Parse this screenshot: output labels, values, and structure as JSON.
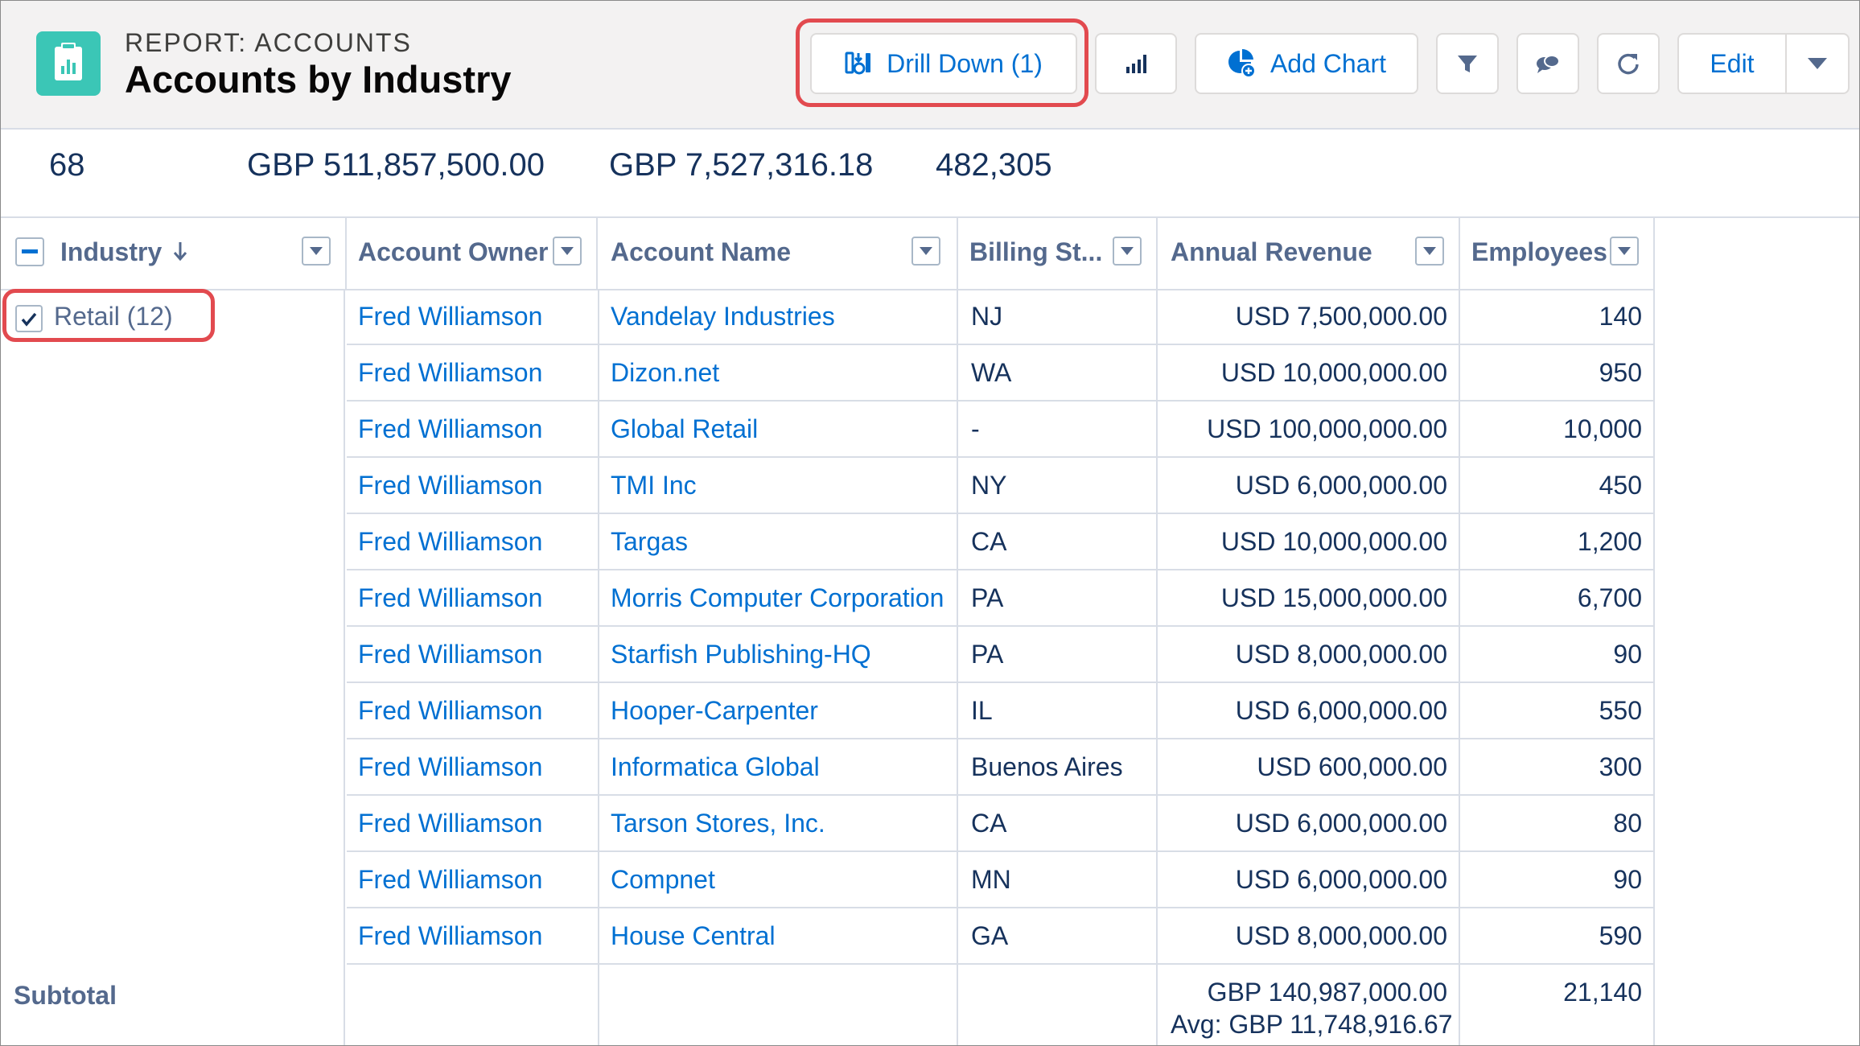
{
  "header": {
    "eyebrow": "REPORT: ACCOUNTS",
    "title": "Accounts by Industry",
    "drill_down_label": "Drill Down (1)",
    "add_chart_label": "Add Chart",
    "edit_label": "Edit"
  },
  "summary": {
    "record_count": "68",
    "total_revenue": "GBP 511,857,500.00",
    "avg_revenue": "GBP 7,527,316.18",
    "total_employees": "482,305"
  },
  "columns": {
    "industry": "Industry",
    "owner": "Account Owner",
    "name": "Account Name",
    "state": "Billing St...",
    "revenue": "Annual Revenue",
    "employees": "Employees"
  },
  "group": {
    "label": "Retail (12)"
  },
  "rows": [
    {
      "owner": "Fred Williamson",
      "name": "Vandelay Industries",
      "state": "NJ",
      "revenue": "USD 7,500,000.00",
      "employees": "140"
    },
    {
      "owner": "Fred Williamson",
      "name": "Dizon.net",
      "state": "WA",
      "revenue": "USD 10,000,000.00",
      "employees": "950"
    },
    {
      "owner": "Fred Williamson",
      "name": "Global Retail",
      "state": "-",
      "revenue": "USD 100,000,000.00",
      "employees": "10,000"
    },
    {
      "owner": "Fred Williamson",
      "name": "TMI Inc",
      "state": "NY",
      "revenue": "USD 6,000,000.00",
      "employees": "450"
    },
    {
      "owner": "Fred Williamson",
      "name": "Targas",
      "state": "CA",
      "revenue": "USD 10,000,000.00",
      "employees": "1,200"
    },
    {
      "owner": "Fred Williamson",
      "name": "Morris Computer Corporation",
      "state": "PA",
      "revenue": "USD 15,000,000.00",
      "employees": "6,700"
    },
    {
      "owner": "Fred Williamson",
      "name": "Starfish Publishing-HQ",
      "state": "PA",
      "revenue": "USD 8,000,000.00",
      "employees": "90"
    },
    {
      "owner": "Fred Williamson",
      "name": "Hooper-Carpenter",
      "state": "IL",
      "revenue": "USD 6,000,000.00",
      "employees": "550"
    },
    {
      "owner": "Fred Williamson",
      "name": "Informatica Global",
      "state": "Buenos Aires",
      "revenue": "USD 600,000.00",
      "employees": "300"
    },
    {
      "owner": "Fred Williamson",
      "name": "Tarson Stores, Inc.",
      "state": "CA",
      "revenue": "USD 6,000,000.00",
      "employees": "80"
    },
    {
      "owner": "Fred Williamson",
      "name": "Compnet",
      "state": "MN",
      "revenue": "USD 6,000,000.00",
      "employees": "90"
    },
    {
      "owner": "Fred Williamson",
      "name": "House Central",
      "state": "GA",
      "revenue": "USD 8,000,000.00",
      "employees": "590"
    }
  ],
  "subtotal": {
    "label": "Subtotal",
    "revenue": "GBP 140,987,000.00",
    "revenue_avg": "Avg: GBP 11,748,916.67",
    "employees": "21,140"
  },
  "icons": {
    "app": "report-icon",
    "drill": "drill-down-icon",
    "chart": "bar-chart-icon",
    "add_chart": "add-chart-icon",
    "filter": "filter-icon",
    "comments": "chat-bubbles-icon",
    "refresh": "refresh-icon",
    "more": "chevron-down-icon",
    "sort": "arrow-down-icon",
    "column_menu": "column-menu-icon",
    "collapse": "minus-icon",
    "check": "checkmark-icon"
  },
  "colors": {
    "brand_link": "#0070d2",
    "app_icon": "#3bc6b6",
    "highlight": "#e24a4f",
    "text_dark": "#16325c",
    "header_bg": "#f3f2f2"
  }
}
